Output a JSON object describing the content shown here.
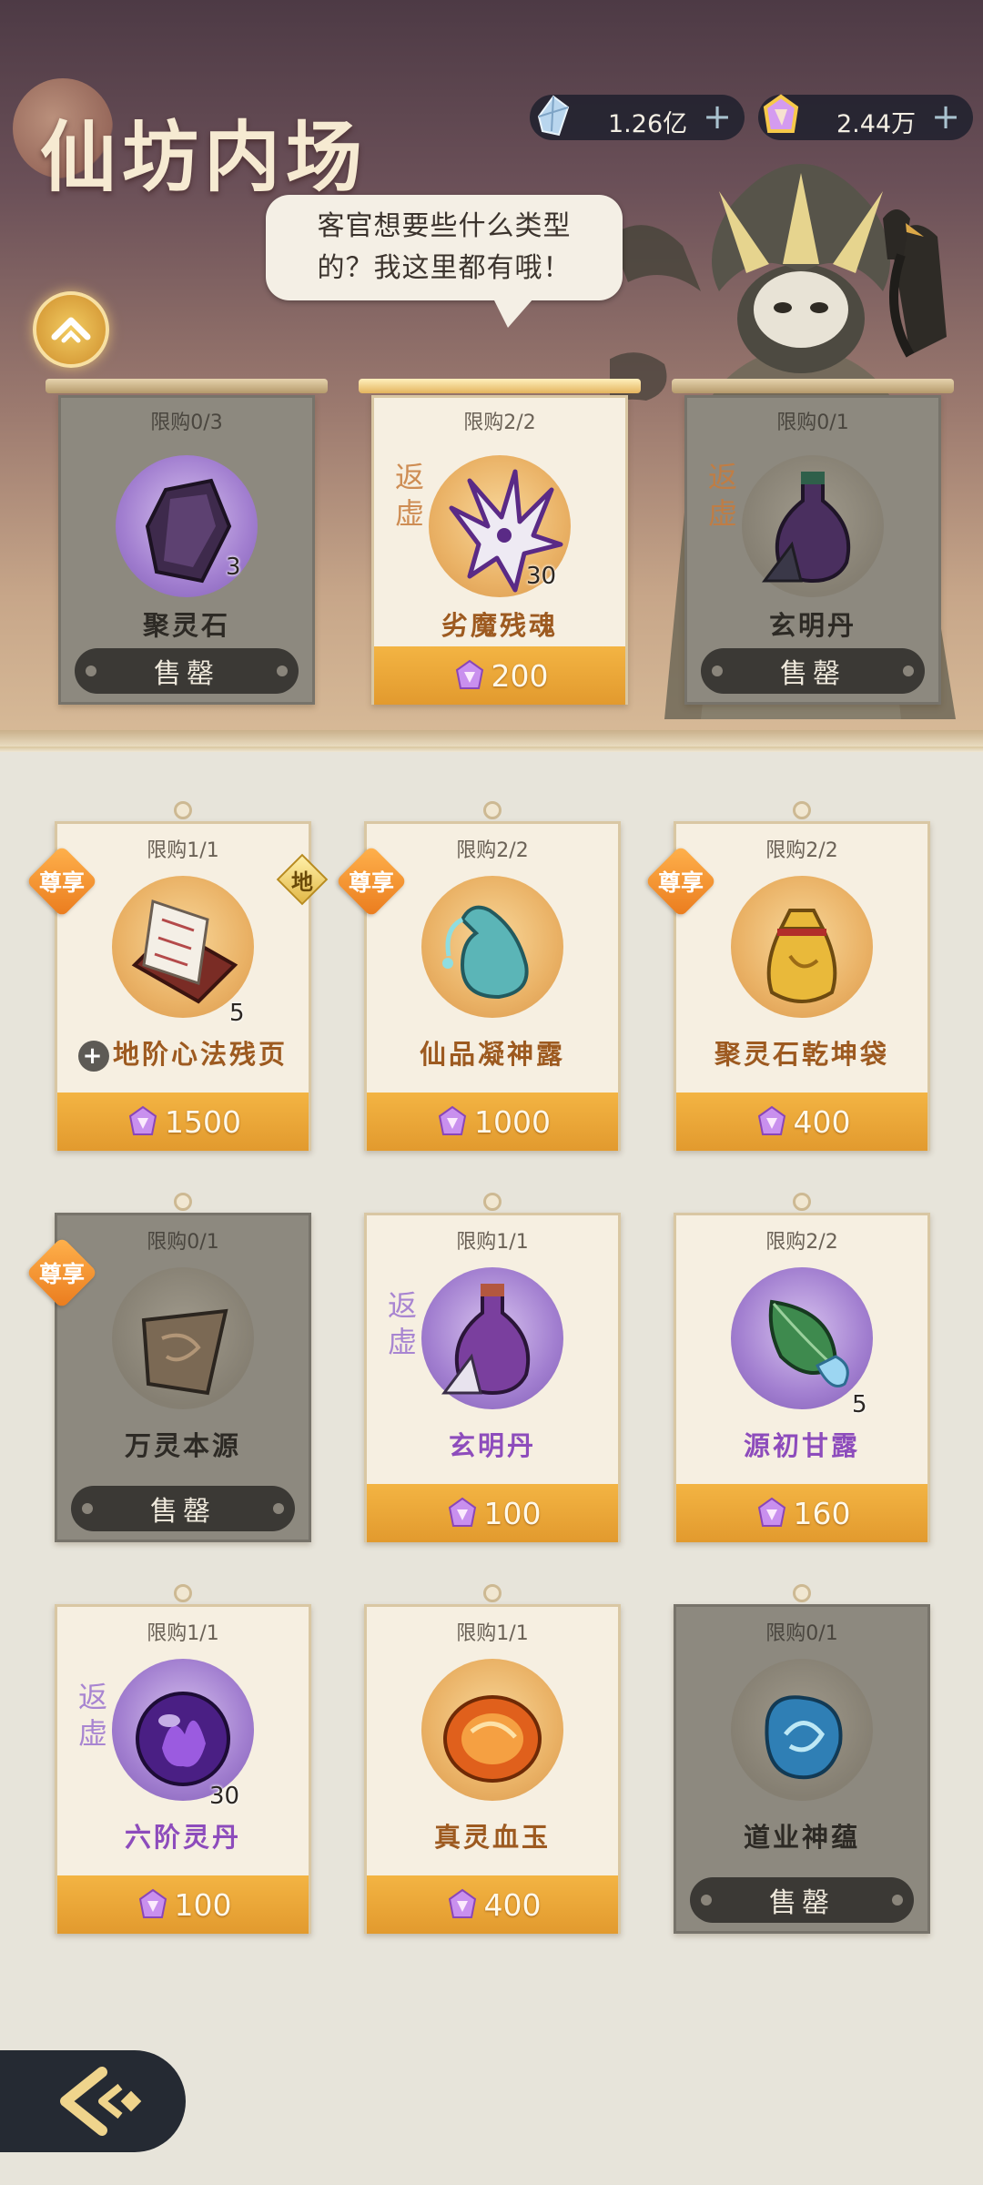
{
  "header": {
    "title": "仙坊内场",
    "currencies": [
      {
        "icon": "spirit-crystal-icon",
        "value": "1.26亿",
        "add_label": "+"
      },
      {
        "icon": "purple-gem-icon",
        "value": "2.44万",
        "add_label": "+"
      }
    ],
    "npc_dialog": [
      "客官想要些什么类型",
      "的？我这里都有哦！"
    ]
  },
  "featured": [
    {
      "limit": "限购0/3",
      "name": "聚灵石",
      "qty": "3",
      "status": "售罄",
      "sold_out": true,
      "name_color": "purple"
    },
    {
      "limit": "限购2/2",
      "name": "劣魔残魂",
      "qty": "30",
      "tag": "返虚",
      "price": "200",
      "sold_out": false,
      "name_color": "orange"
    },
    {
      "limit": "限购0/1",
      "name": "玄明丹",
      "tag": "返虚",
      "status": "售罄",
      "sold_out": true,
      "name_color": "orange"
    }
  ],
  "items": [
    {
      "limit": "限购1/1",
      "name": "地阶心法残页",
      "qty": "5",
      "vip": "尊享",
      "tier": "地",
      "price": "1500",
      "locked_mark": "+"
    },
    {
      "limit": "限购2/2",
      "name": "仙品凝神露",
      "vip": "尊享",
      "price": "1000"
    },
    {
      "limit": "限购2/2",
      "name": "聚灵石乾坤袋",
      "vip": "尊享",
      "price": "400"
    },
    {
      "limit": "限购0/1",
      "name": "万灵本源",
      "vip": "尊享",
      "status": "售罄",
      "sold_out": true
    },
    {
      "limit": "限购1/1",
      "name": "玄明丹",
      "tag": "返虚",
      "price": "100"
    },
    {
      "limit": "限购2/2",
      "name": "源初甘露",
      "qty": "5",
      "price": "160"
    },
    {
      "limit": "限购1/1",
      "name": "六阶灵丹",
      "tag": "返虚",
      "qty": "30",
      "price": "100"
    },
    {
      "limit": "限购1/1",
      "name": "真灵血玉",
      "price": "400"
    },
    {
      "limit": "限购0/1",
      "name": "道业神蕴",
      "status": "售罄",
      "sold_out": true
    }
  ],
  "colors": {
    "price_bar": "#e8a336",
    "vip_badge": "#f08a24",
    "name_orange": "#9d5a20",
    "name_purple": "#8d4cbc"
  }
}
